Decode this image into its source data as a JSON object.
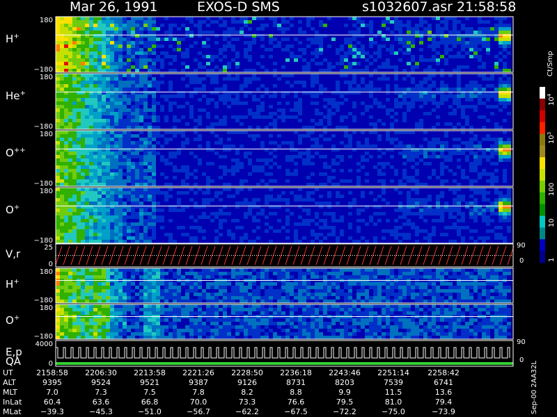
{
  "header": {
    "date": "Mar 26, 1991",
    "instrument": "EXOS-D SMS",
    "file": "s1032607.asr",
    "time": "21:58:58"
  },
  "colorbar": {
    "unit": "Ct/Smp",
    "ticks": [
      "10",
      "10",
      "100",
      "10",
      "1"
    ],
    "tick_exponents": [
      "4",
      "3",
      "",
      "",
      ""
    ],
    "colors": [
      "#ffffff",
      "#8b0000",
      "#d00000",
      "#ff2000",
      "#8b7a10",
      "#a08a20",
      "#ffe000",
      "#c8e000",
      "#78d000",
      "#30b000",
      "#009000",
      "#00c8c8",
      "#008888",
      "#0000c0",
      "#00008a"
    ]
  },
  "chart_data": [
    {
      "type": "heatmap",
      "label": "H",
      "label_sup": "+",
      "ylim": [
        -180,
        180
      ],
      "tick_top": "180",
      "tick_bottom": "−180",
      "grid": false
    },
    {
      "type": "heatmap",
      "label": "He",
      "label_sup": "+",
      "ylim": [
        -180,
        180
      ],
      "tick_top": "180",
      "tick_bottom": "−180",
      "grid": false
    },
    {
      "type": "heatmap",
      "label": "O",
      "label_sup": "++",
      "ylim": [
        -180,
        180
      ],
      "tick_top": "180",
      "tick_bottom": "−180",
      "grid": false
    },
    {
      "type": "heatmap",
      "label": "O",
      "label_sup": "+",
      "ylim": [
        -180,
        180
      ],
      "tick_top": "180",
      "tick_bottom": "−180",
      "grid": false
    },
    {
      "type": "line",
      "label": "V,r",
      "tick_top": "25",
      "tick_bottom": "0",
      "right_top": "90",
      "right_bottom": "0",
      "color": "#ff3030"
    },
    {
      "type": "heatmap",
      "label": "H",
      "label_sup": "+",
      "ylim": [
        -180,
        180
      ],
      "tick_top": "180",
      "tick_bottom": "−180",
      "grid": false
    },
    {
      "type": "heatmap",
      "label": "O",
      "label_sup": "+",
      "ylim": [
        -180,
        180
      ],
      "tick_top": "180",
      "tick_bottom": "−180",
      "grid": false
    },
    {
      "type": "line",
      "label": "E,p",
      "label2": "QA",
      "tick_top": "4000",
      "tick_bottom": "0",
      "right_top": "90",
      "right_bottom": "0"
    }
  ],
  "ephemeris": {
    "rows": [
      {
        "name": "UT",
        "values": [
          "2158:58",
          "2206:30",
          "2213:58",
          "2221:26",
          "2228:50",
          "2236:18",
          "2243:46",
          "2251:14",
          "2258:42"
        ]
      },
      {
        "name": "ALT",
        "values": [
          "9395",
          "9524",
          "9521",
          "9387",
          "9126",
          "8731",
          "8203",
          "7539",
          "6741"
        ]
      },
      {
        "name": "MLT",
        "values": [
          "7.0",
          "7.3",
          "7.5",
          "7.8",
          "8.2",
          "8.8",
          "9.9",
          "11.5",
          "13.6"
        ]
      },
      {
        "name": "InLat",
        "values": [
          "60.4",
          "63.6",
          "66.8",
          "70.0",
          "73.3",
          "76.6",
          "79.5",
          "81.0",
          "79.4"
        ]
      },
      {
        "name": "MLat",
        "values": [
          "−39.3",
          "−45.3",
          "−51.0",
          "−56.7",
          "−62.2",
          "−67.5",
          "−72.2",
          "−75.0",
          "−73.9"
        ]
      }
    ]
  },
  "footer_code": "Sep-00 2AA32L"
}
